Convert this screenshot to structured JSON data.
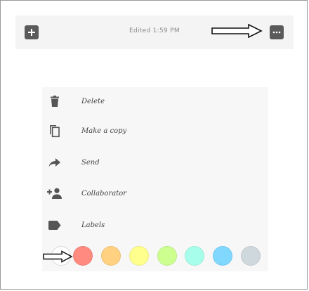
{
  "toolbar": {
    "add_icon": "plus-icon",
    "edited_text": "Edited 1:59 PM",
    "more_icon": "more-horiz-icon"
  },
  "menu": {
    "items": [
      {
        "label": "Delete",
        "icon": "trash-icon"
      },
      {
        "label": "Make a copy",
        "icon": "copy-icon"
      },
      {
        "label": "Send",
        "icon": "share-icon"
      },
      {
        "label": "Collaborator",
        "icon": "person-add-icon"
      },
      {
        "label": "Labels",
        "icon": "label-icon"
      }
    ],
    "colors": [
      {
        "name": "white",
        "hex": "#ffffff"
      },
      {
        "name": "red",
        "hex": "#ff8a80"
      },
      {
        "name": "orange",
        "hex": "#ffd180"
      },
      {
        "name": "yellow",
        "hex": "#ffff8d"
      },
      {
        "name": "green",
        "hex": "#ccff90"
      },
      {
        "name": "teal",
        "hex": "#a7ffeb"
      },
      {
        "name": "blue",
        "hex": "#80d8ff"
      },
      {
        "name": "gray",
        "hex": "#cfd8dc"
      }
    ]
  },
  "theme": {
    "toolbar_bg": "#f4f4f4",
    "menu_bg": "#f7f7f7",
    "icon_color": "#555555"
  }
}
